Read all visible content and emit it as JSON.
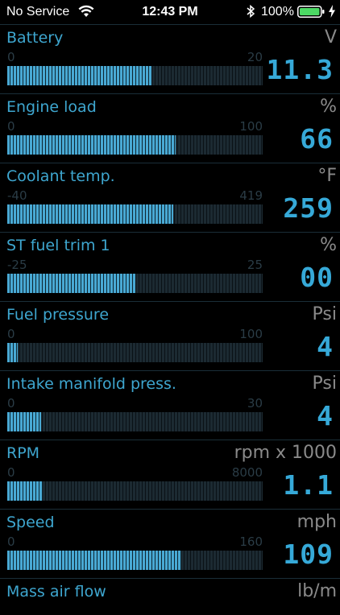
{
  "status_bar": {
    "carrier": "No Service",
    "time": "12:43 PM",
    "battery_percent": "100%"
  },
  "colors": {
    "accent": "#36a9d8",
    "bar_fill": "#49a9d4",
    "background": "#000000"
  },
  "gauges": [
    {
      "label": "Battery",
      "unit": "V",
      "min": "0",
      "max": "20",
      "value": "11.3",
      "fill_fraction": 0.565
    },
    {
      "label": "Engine load",
      "unit": "%",
      "min": "0",
      "max": "100",
      "value": "66",
      "fill_fraction": 0.66
    },
    {
      "label": "Coolant temp.",
      "unit": "°F",
      "min": "-40",
      "max": "419",
      "value": "259",
      "fill_fraction": 0.651
    },
    {
      "label": "ST fuel trim 1",
      "unit": "%",
      "min": "-25",
      "max": "25",
      "value": "00",
      "fill_fraction": 0.5
    },
    {
      "label": "Fuel pressure",
      "unit": "Psi",
      "min": "0",
      "max": "100",
      "value": "4",
      "fill_fraction": 0.04
    },
    {
      "label": "Intake manifold press.",
      "unit": "Psi",
      "min": "0",
      "max": "30",
      "value": "4",
      "fill_fraction": 0.133
    },
    {
      "label": "RPM",
      "unit": "rpm x 1000",
      "min": "0",
      "max": "8000",
      "value": "1.1",
      "fill_fraction": 0.1375
    },
    {
      "label": "Speed",
      "unit": "mph",
      "min": "0",
      "max": "160",
      "value": "109",
      "fill_fraction": 0.68
    },
    {
      "label": "Mass air flow",
      "unit": "lb/m"
    }
  ]
}
